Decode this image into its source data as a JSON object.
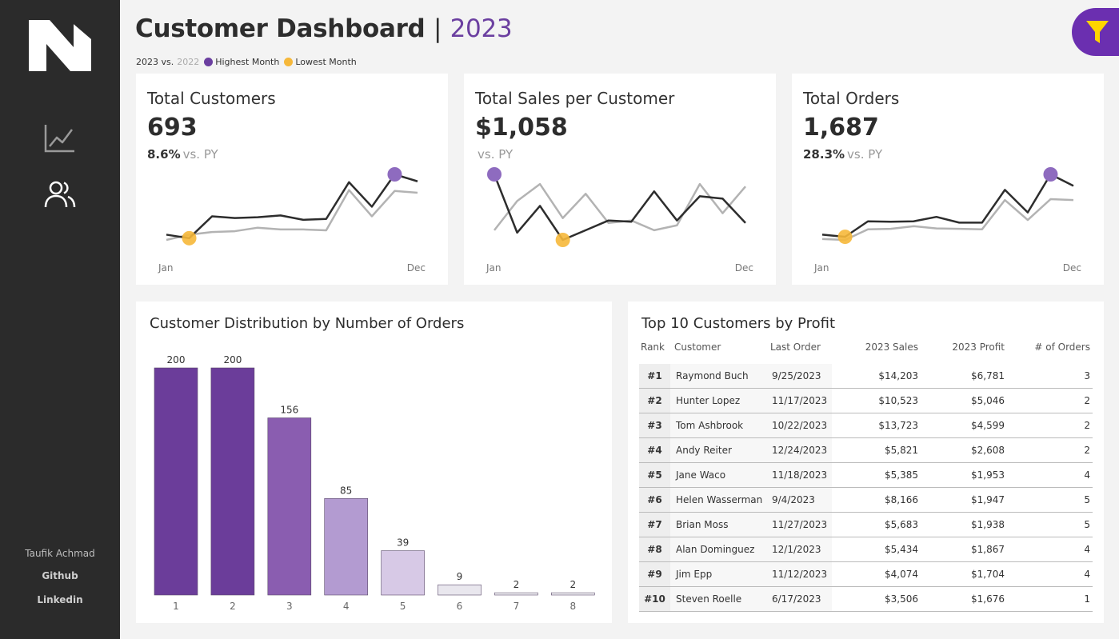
{
  "sidebar": {
    "nav": [
      {
        "icon": "line-chart-icon"
      },
      {
        "icon": "users-icon"
      }
    ],
    "author": "Taufik Achmad",
    "github": "Github",
    "linkedin": "Linkedin"
  },
  "header": {
    "title": "Customer Dashboard",
    "separator": "|",
    "year": "2023",
    "legend": {
      "current": "2023 vs.",
      "prior": "2022",
      "highest": "Highest Month",
      "lowest": "Lowest Month"
    },
    "filter_icon": "filter-icon"
  },
  "colors": {
    "accent": "#6b3fa0",
    "current_line": "#2d2d2d",
    "prior_line": "#b3b3b3",
    "highest": "#8e6bbf",
    "lowest": "#f6b83a"
  },
  "kpis": [
    {
      "title": "Total Customers",
      "value": "693",
      "change": "8.6%",
      "vs": "vs. PY",
      "x_start": "Jan",
      "x_end": "Dec"
    },
    {
      "title": "Total Sales per Customer",
      "value": "$1,058",
      "change": "",
      "vs": "vs. PY",
      "x_start": "Jan",
      "x_end": "Dec"
    },
    {
      "title": "Total Orders",
      "value": "1,687",
      "change": "28.3%",
      "vs": "vs. PY",
      "x_start": "Jan",
      "x_end": "Dec"
    }
  ],
  "chart_data": [
    {
      "type": "line",
      "title": "Total Customers",
      "x": [
        "Jan",
        "Feb",
        "Mar",
        "Apr",
        "May",
        "Jun",
        "Jul",
        "Aug",
        "Sep",
        "Oct",
        "Nov",
        "Dec"
      ],
      "series": [
        {
          "name": "2023",
          "values": [
            39,
            35,
            60,
            58,
            59,
            61,
            56,
            57,
            99,
            71,
            108,
            100
          ],
          "highest_index": 10,
          "lowest_index": 1
        },
        {
          "name": "2022",
          "values": [
            33,
            39,
            42,
            43,
            47,
            45,
            45,
            44,
            90,
            60,
            89,
            87
          ]
        }
      ]
    },
    {
      "type": "line",
      "title": "Total Sales per Customer",
      "x": [
        "Jan",
        "Feb",
        "Mar",
        "Apr",
        "May",
        "Jun",
        "Jul",
        "Aug",
        "Sep",
        "Oct",
        "Nov",
        "Dec"
      ],
      "series": [
        {
          "name": "2023",
          "values": [
            1250,
            1010,
            1120,
            980,
            1020,
            1060,
            1055,
            1180,
            1060,
            1160,
            1150,
            1050
          ],
          "highest_index": 0,
          "lowest_index": 3
        },
        {
          "name": "2022",
          "values": [
            1020,
            1140,
            1210,
            1070,
            1170,
            1050,
            1060,
            1020,
            1040,
            1210,
            1090,
            1200
          ]
        }
      ]
    },
    {
      "type": "line",
      "title": "Total Orders",
      "x": [
        "Jan",
        "Feb",
        "Mar",
        "Apr",
        "May",
        "Jun",
        "Jul",
        "Aug",
        "Sep",
        "Oct",
        "Nov",
        "Dec"
      ],
      "series": [
        {
          "name": "2023",
          "values": [
            60,
            55,
            90,
            89,
            90,
            100,
            87,
            87,
            161,
            110,
            196,
            170
          ],
          "highest_index": 10,
          "lowest_index": 1
        },
        {
          "name": "2022",
          "values": [
            50,
            48,
            72,
            73,
            79,
            74,
            73,
            72,
            138,
            93,
            140,
            138
          ]
        }
      ]
    },
    {
      "type": "bar",
      "title": "Customer Distribution by Number of Orders",
      "categories": [
        "1",
        "2",
        "3",
        "4",
        "5",
        "6",
        "7",
        "8"
      ],
      "values": [
        200,
        200,
        156,
        85,
        39,
        9,
        2,
        2
      ],
      "ylim": [
        0,
        200
      ]
    }
  ],
  "table": {
    "title": "Top 10 Customers by Profit",
    "columns": [
      "Rank",
      "Customer",
      "Last Order",
      "2023 Sales",
      "2023 Profit",
      "# of Orders"
    ],
    "rows": [
      [
        "#1",
        "Raymond Buch",
        "9/25/2023",
        "$14,203",
        "$6,781",
        "3"
      ],
      [
        "#2",
        "Hunter Lopez",
        "11/17/2023",
        "$10,523",
        "$5,046",
        "2"
      ],
      [
        "#3",
        "Tom Ashbrook",
        "10/22/2023",
        "$13,723",
        "$4,599",
        "2"
      ],
      [
        "#4",
        "Andy Reiter",
        "12/24/2023",
        "$5,821",
        "$2,608",
        "2"
      ],
      [
        "#5",
        "Jane Waco",
        "11/18/2023",
        "$5,385",
        "$1,953",
        "4"
      ],
      [
        "#6",
        "Helen Wasserman",
        "9/4/2023",
        "$8,166",
        "$1,947",
        "5"
      ],
      [
        "#7",
        "Brian Moss",
        "11/27/2023",
        "$5,683",
        "$1,938",
        "5"
      ],
      [
        "#8",
        "Alan Dominguez",
        "12/1/2023",
        "$5,434",
        "$1,867",
        "4"
      ],
      [
        "#9",
        "Jim Epp",
        "11/12/2023",
        "$4,074",
        "$1,704",
        "4"
      ],
      [
        "#10",
        "Steven Roelle",
        "6/17/2023",
        "$3,506",
        "$1,676",
        "1"
      ]
    ]
  }
}
